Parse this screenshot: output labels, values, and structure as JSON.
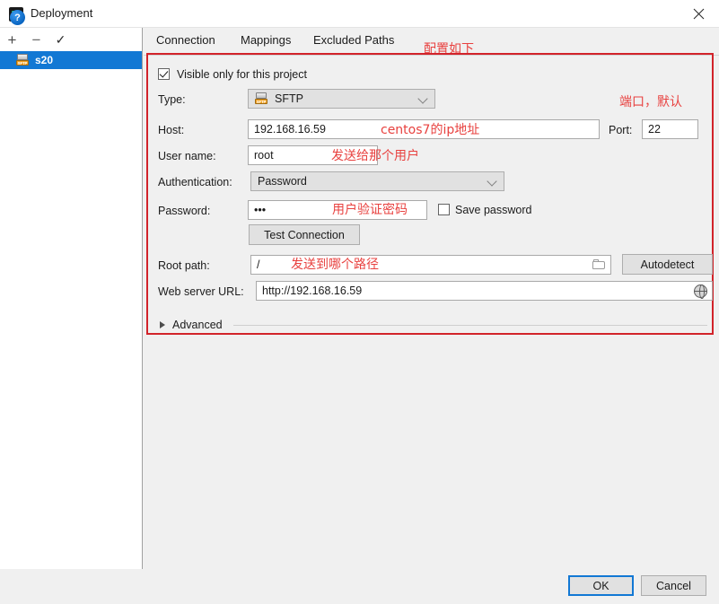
{
  "window": {
    "title": "Deployment",
    "app_icon_text": "PC",
    "close_label": "×"
  },
  "sidebar": {
    "toolbar": {
      "add_label": "+",
      "remove_label": "−",
      "use_as_default_label": "✓"
    },
    "items": [
      {
        "label": "s20",
        "icon": "sftp-server-icon",
        "selected": true
      }
    ]
  },
  "tabs": [
    {
      "label": "Connection",
      "active": true
    },
    {
      "label": "Mappings",
      "active": false
    },
    {
      "label": "Excluded Paths",
      "active": false
    }
  ],
  "annotations": {
    "tabs_note": "配置如下",
    "host_note": "centos7的ip地址",
    "port_note": "端口，默认",
    "username_note": "发送给那个用户",
    "password_note": "用户验证密码",
    "rootpath_note": "发送到哪个路径"
  },
  "form": {
    "visible_only_checkbox": {
      "label": "Visible only for this project",
      "checked": true
    },
    "type": {
      "label": "Type:",
      "value": "SFTP",
      "icon": "sftp-server-icon"
    },
    "host": {
      "label": "Host:",
      "value": "192.168.16.59"
    },
    "port": {
      "label": "Port:",
      "value": "22"
    },
    "user_name": {
      "label": "User name:",
      "value": "root"
    },
    "authentication": {
      "label": "Authentication:",
      "value": "Password"
    },
    "password": {
      "label": "Password:",
      "value": "•••"
    },
    "save_password": {
      "label": "Save password",
      "checked": false
    },
    "test_connection_button": "Test Connection",
    "root_path": {
      "label": "Root path:",
      "value": "/",
      "browse_icon": "folder-icon"
    },
    "autodetect_button": "Autodetect",
    "web_server_url": {
      "label": "Web server URL:",
      "value": "http://192.168.16.59",
      "open_icon": "globe-icon"
    },
    "advanced": {
      "label": "Advanced",
      "expanded": false
    }
  },
  "footer": {
    "help_label": "?",
    "ok_label": "OK",
    "cancel_label": "Cancel"
  },
  "colors": {
    "accent": "#1278d4",
    "annotation_red": "#e8413f",
    "rect_red": "#d2232a",
    "tab_underline": "#4386c6"
  }
}
